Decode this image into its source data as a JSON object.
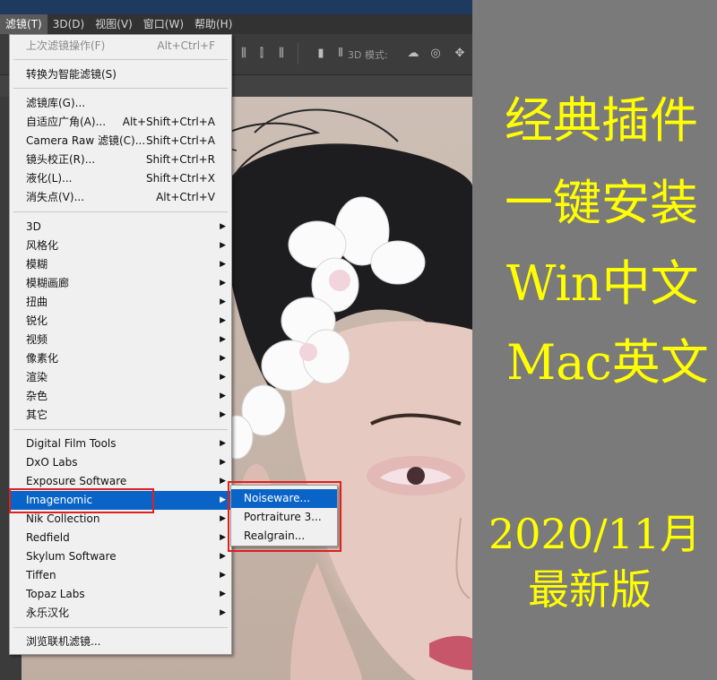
{
  "menubar": {
    "items": [
      "滤镜(T)",
      "3D(D)",
      "视图(V)",
      "窗口(W)",
      "帮助(H)"
    ]
  },
  "options": {
    "mode3d_label": "3D 模式:"
  },
  "filter_menu": {
    "last_filter": {
      "label": "上次滤镜操作(F)",
      "shortcut": "Alt+Ctrl+F"
    },
    "convert_smart": "转换为智能滤镜(S)",
    "group1": [
      {
        "label": "滤镜库(G)...",
        "shortcut": ""
      },
      {
        "label": "自适应广角(A)...",
        "shortcut": "Alt+Shift+Ctrl+A"
      },
      {
        "label": "Camera Raw 滤镜(C)...",
        "shortcut": "Shift+Ctrl+A"
      },
      {
        "label": "镜头校正(R)...",
        "shortcut": "Shift+Ctrl+R"
      },
      {
        "label": "液化(L)...",
        "shortcut": "Shift+Ctrl+X"
      },
      {
        "label": "消失点(V)...",
        "shortcut": "Alt+Ctrl+V"
      }
    ],
    "group2": [
      "3D",
      "风格化",
      "模糊",
      "模糊画廊",
      "扭曲",
      "锐化",
      "视频",
      "像素化",
      "渲染",
      "杂色",
      "其它"
    ],
    "group3": [
      "Digital Film Tools",
      "DxO Labs",
      "Exposure Software",
      "Imagenomic",
      "Nik Collection",
      "Redfield",
      "Skylum Software",
      "Tiffen",
      "Topaz Labs",
      "永乐汉化"
    ],
    "browse_online": "浏览联机滤镜..."
  },
  "submenu": {
    "items": [
      "Noiseware...",
      "Portraiture 3...",
      "Realgrain..."
    ]
  },
  "promo": {
    "line1": "经典插件",
    "line2": "一键安装",
    "line3": "Win中文",
    "line4": "Mac英文",
    "line5": "2020/11月",
    "line6": "最新版",
    "color": "#ffff00"
  },
  "colors": {
    "highlight": "#0a64c8",
    "callout": "#e0201f"
  }
}
